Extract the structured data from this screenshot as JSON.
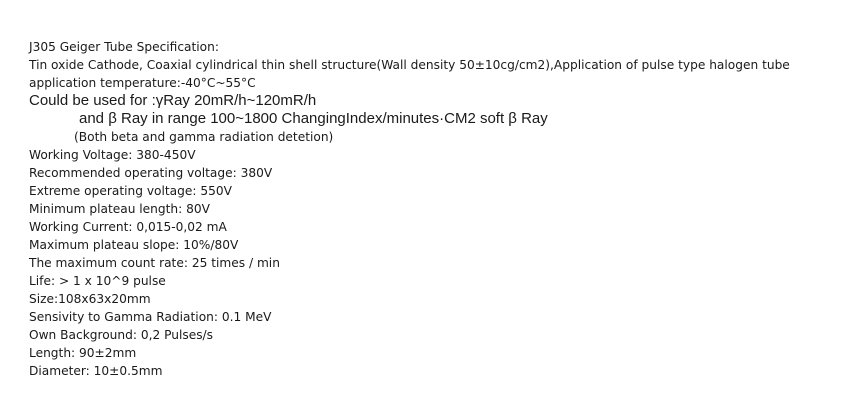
{
  "document": {
    "title": "J305 Geiger Tube Specification:",
    "structure": "Tin oxide Cathode, Coaxial cylindrical thin shell structure(Wall density 50±10cg/cm2),Application of pulse type halogen tube",
    "temperature": "application temperature:-40°C~55°C",
    "usage_line_1": "Could be used for :γRay 20mR/h~120mR/h",
    "usage_line_2": "and β Ray in range  100~1800 ChangingIndex/minutes·CM2 soft β Ray",
    "usage_note": "(Both beta and gamma radiation detetion)",
    "specs": [
      "Working Voltage: 380-450V",
      "Recommended operating voltage: 380V",
      "Extreme operating voltage: 550V",
      "Minimum plateau length: 80V",
      "Working Current: 0,015-0,02 mA",
      "Maximum plateau slope: 10%/80V",
      "The maximum count rate: 25 times / min",
      "Life: > 1 x 10^9 pulse",
      "Size:108x63x20mm",
      "Sensivity to Gamma Radiation: 0.1 MeV",
      "Own Background: 0,2 Pulses/s",
      "Length:  90±2mm",
      "Diameter: 10±0.5mm"
    ]
  }
}
